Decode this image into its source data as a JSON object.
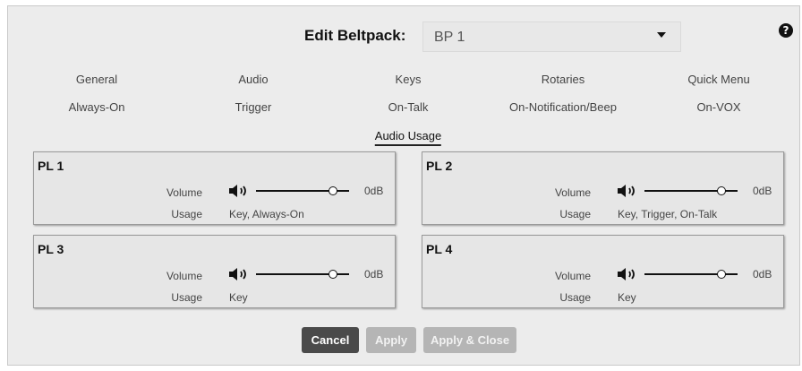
{
  "header": {
    "label": "Edit Beltpack:",
    "selected_device": "BP 1",
    "help": "?"
  },
  "tabs": {
    "row1": [
      "General",
      "Audio",
      "Keys",
      "Rotaries",
      "Quick Menu"
    ],
    "row2": [
      "Always-On",
      "Trigger",
      "On-Talk",
      "On-Notification/Beep",
      "On-VOX"
    ],
    "active": "Audio Usage"
  },
  "labels": {
    "volume": "Volume",
    "usage": "Usage"
  },
  "panels": [
    {
      "title": "PL 1",
      "volume_db": "0dB",
      "volume_level": 0.83,
      "usage": "Key, Always-On"
    },
    {
      "title": "PL 2",
      "volume_db": "0dB",
      "volume_level": 0.83,
      "usage": "Key, Trigger, On-Talk"
    },
    {
      "title": "PL 3",
      "volume_db": "0dB",
      "volume_level": 0.83,
      "usage": "Key"
    },
    {
      "title": "PL 4",
      "volume_db": "0dB",
      "volume_level": 0.83,
      "usage": "Key"
    }
  ],
  "buttons": {
    "cancel": "Cancel",
    "apply": "Apply",
    "apply_close": "Apply & Close"
  }
}
